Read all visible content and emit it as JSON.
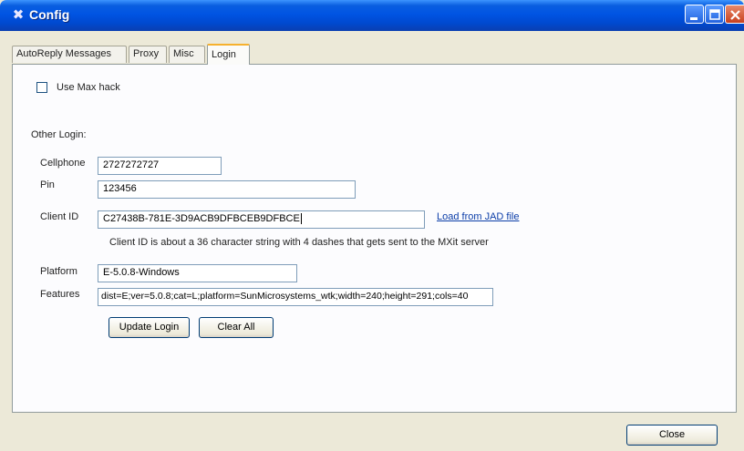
{
  "window": {
    "title": "Config"
  },
  "tabs": [
    {
      "label": "AutoReply Messages",
      "active": false
    },
    {
      "label": "Proxy",
      "active": false
    },
    {
      "label": "Misc",
      "active": false
    },
    {
      "label": "Login",
      "active": true
    }
  ],
  "login": {
    "use_max_hack_label": "Use Max hack",
    "use_max_hack_checked": false,
    "other_login_label": "Other Login:",
    "cellphone_label": "Cellphone",
    "cellphone_value": "2727272727",
    "pin_label": "Pin",
    "pin_value": "123456",
    "client_id_label": "Client ID",
    "client_id_value": "C27438B-781E-3D9ACB9DFBCEB9DFBCE",
    "load_jad_link": "Load from JAD file",
    "client_id_hint": "Client ID is about a 36 character string with 4 dashes that gets sent to the MXit server",
    "platform_label": "Platform",
    "platform_value": "E-5.0.8-Windows",
    "features_label": "Features",
    "features_value": "dist=E;ver=5.0.8;cat=L;platform=SunMicrosystems_wtk;width=240;height=291;cols=40",
    "update_login_button": "Update Login",
    "clear_all_button": "Clear All"
  },
  "footer": {
    "close_button": "Close"
  }
}
